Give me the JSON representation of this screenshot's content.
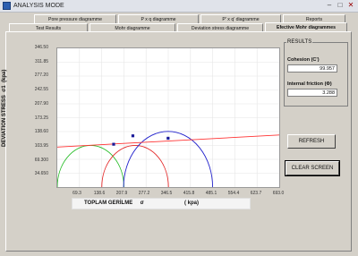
{
  "window": {
    "title": "ANALYSIS MODE"
  },
  "tabs_back": [
    "Pore pressure diagramme",
    "P' x q' diagramme",
    "P x q diagramme",
    "Reports"
  ],
  "tabs_front": [
    "Test Results",
    "Mohr diagramme",
    "Deviation stress diagramme",
    "Efective Mohr diagrammes"
  ],
  "chart_data": {
    "type": "scatter",
    "ylabel": "DEVIATION STRESS",
    "ylabel_symbol": "σ1",
    "ylabel_unit": "(kpa)",
    "xlabel": "TOPLAM GERİLME",
    "xlabel_symbol": "σ",
    "xlabel_unit": "( kpa)",
    "y_ticks": [
      "346.50",
      "311.85",
      "277.20",
      "242.55",
      "207.90",
      "173.25",
      "138.60",
      "103.95",
      "69.300",
      "34.650"
    ],
    "x_ticks": [
      "69.3",
      "138.6",
      "207.9",
      "277.2",
      "346.5",
      "415.8",
      "485.1",
      "554.4",
      "623.7",
      "693.0"
    ],
    "xlim": [
      0,
      693.0
    ],
    "ylim": [
      0,
      346.5
    ],
    "grid": true,
    "failure_envelope": {
      "color": "#ff3333",
      "y_at_x0": 100.0,
      "y_at_xmax": 130.0
    },
    "circles": [
      {
        "color": "#22bb22",
        "center": 104,
        "radius": 104
      },
      {
        "color": "#e22222",
        "center": 243,
        "radius": 104
      },
      {
        "color": "#2222cc",
        "center": 346,
        "radius": 139
      }
    ],
    "tangent_points": [
      {
        "x": 176,
        "y": 107
      },
      {
        "x": 236,
        "y": 128
      },
      {
        "x": 346,
        "y": 122
      }
    ]
  },
  "results": {
    "title": "RESULTS",
    "cohesion_label": "Cohesion (C')",
    "cohesion_value": "99.957",
    "friction_label": "Internal friction",
    "friction_symbol": "(Φ)",
    "friction_value": "3.288"
  },
  "buttons": {
    "refresh": "REFRESH",
    "clear": "CLEAR SCREEN"
  }
}
